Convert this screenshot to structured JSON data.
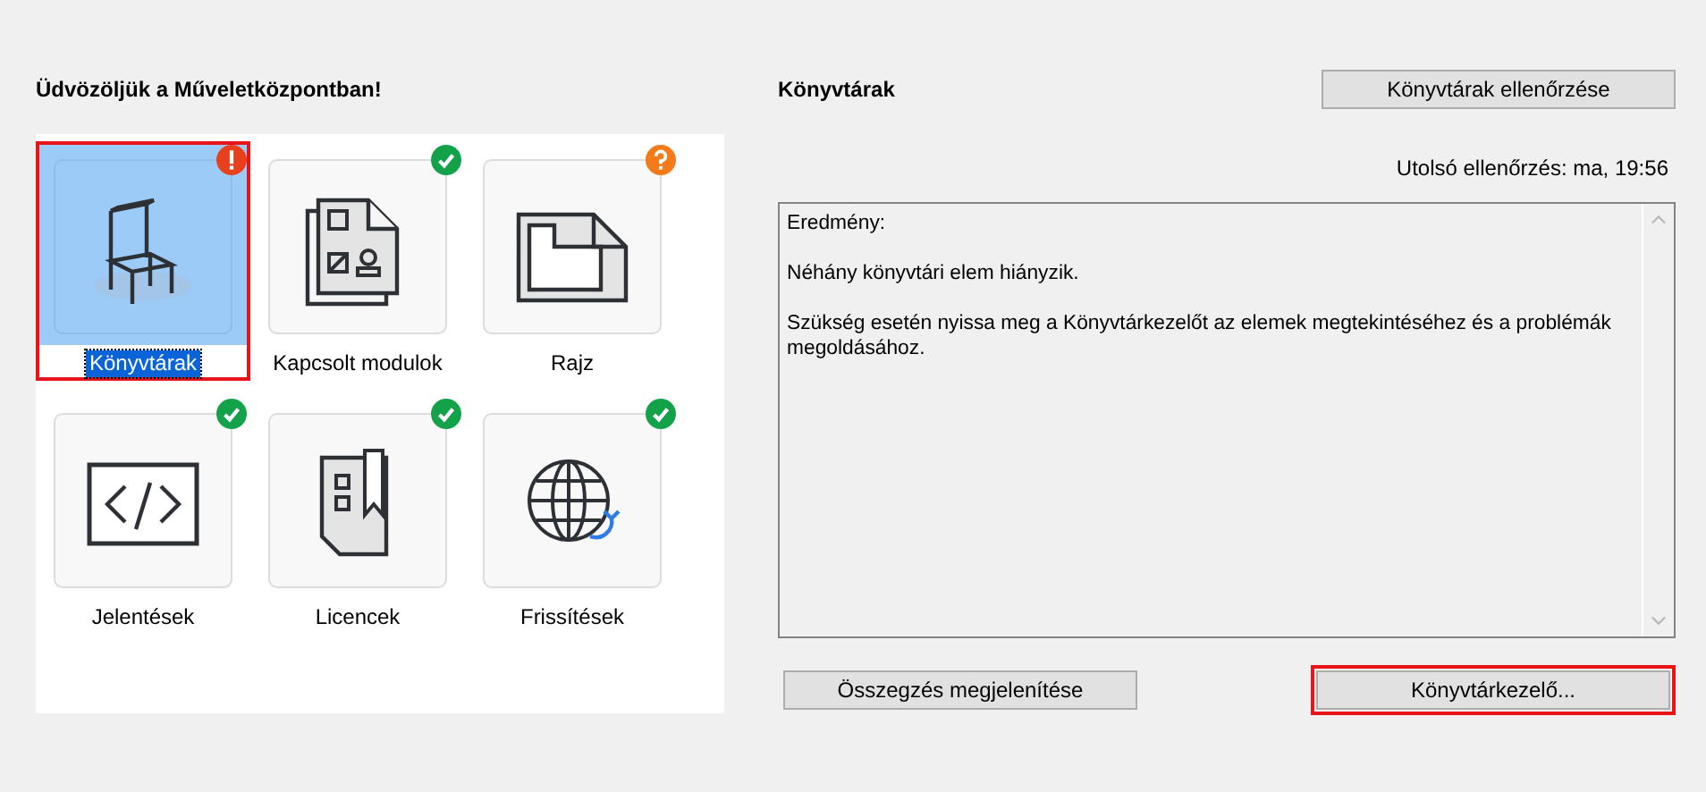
{
  "welcome_title": "Üdvözöljük a Műveletközpontban!",
  "tiles": [
    {
      "label": "Könyvtárak",
      "kind": "error",
      "selected": true
    },
    {
      "label": "Kapcsolt modulok",
      "kind": "ok",
      "selected": false
    },
    {
      "label": "Rajz",
      "kind": "warning",
      "selected": false
    },
    {
      "label": "Jelentések",
      "kind": "ok",
      "selected": false
    },
    {
      "label": "Licencek",
      "kind": "ok",
      "selected": false
    },
    {
      "label": "Frissítések",
      "kind": "ok",
      "selected": false
    }
  ],
  "detail": {
    "title": "Könyvtárak",
    "check_button": "Könyvtárak ellenőrzése",
    "last_check": "Utolsó ellenőrzés: ma, 19:56",
    "result_lines": [
      "Eredmény:",
      "Néhány könyvtári elem hiányzik.",
      "Szükség esetén nyissa meg a Könyvtárkezelőt az elemek megtekintéséhez és a problémák megoldásához."
    ]
  },
  "buttons": [
    {
      "label": "Összegzés megjelenítése",
      "highlighted": false
    },
    {
      "label": "Könyvtárkezelő...",
      "highlighted": true
    }
  ]
}
